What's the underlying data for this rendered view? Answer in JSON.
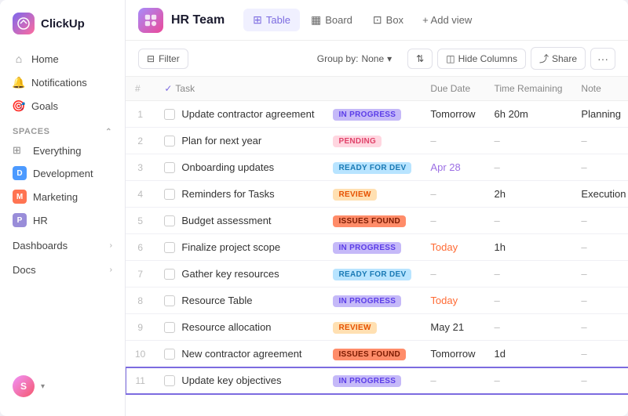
{
  "sidebar": {
    "logo": "ClickUp",
    "nav": [
      {
        "id": "home",
        "label": "Home",
        "icon": "⌂"
      },
      {
        "id": "notifications",
        "label": "Notifications",
        "icon": "🔔"
      },
      {
        "id": "goals",
        "label": "Goals",
        "icon": "🎯"
      }
    ],
    "spaces_label": "Spaces",
    "spaces": [
      {
        "id": "everything",
        "label": "Everything",
        "icon": null
      },
      {
        "id": "development",
        "label": "Development",
        "letter": "D",
        "color": "dot-blue"
      },
      {
        "id": "marketing",
        "label": "Marketing",
        "letter": "M",
        "color": "dot-orange"
      },
      {
        "id": "hr",
        "label": "HR",
        "letter": "P",
        "color": "dot-purple"
      }
    ],
    "bottom_nav": [
      {
        "id": "dashboards",
        "label": "Dashboards"
      },
      {
        "id": "docs",
        "label": "Docs"
      }
    ],
    "avatar_letter": "S"
  },
  "header": {
    "team_name": "HR Team",
    "tabs": [
      {
        "id": "table",
        "label": "Table",
        "icon": "⊞",
        "active": true
      },
      {
        "id": "board",
        "label": "Board",
        "icon": "▦",
        "active": false
      },
      {
        "id": "box",
        "label": "Box",
        "icon": "⊡",
        "active": false
      }
    ],
    "add_view": "+ Add view"
  },
  "toolbar": {
    "filter_label": "Filter",
    "group_by_label": "Group by:",
    "group_by_value": "None",
    "hide_columns_label": "Hide Columns",
    "share_label": "Share"
  },
  "table": {
    "columns": [
      "#",
      "Task",
      "",
      "Due Date",
      "Time Remaining",
      "Note"
    ],
    "rows": [
      {
        "num": 1,
        "task": "Update contractor agreement",
        "status": "IN PROGRESS",
        "status_type": "inprogress",
        "due": "Tomorrow",
        "due_type": "tomorrow",
        "time": "6h 20m",
        "note": "Planning"
      },
      {
        "num": 2,
        "task": "Plan for next year",
        "status": "PENDING",
        "status_type": "pending",
        "due": "–",
        "due_type": "dash",
        "time": "–",
        "note": "–"
      },
      {
        "num": 3,
        "task": "Onboarding updates",
        "status": "READY FOR DEV",
        "status_type": "readyfordev",
        "due": "Apr 28",
        "due_type": "apr",
        "time": "–",
        "note": "–"
      },
      {
        "num": 4,
        "task": "Reminders for Tasks",
        "status": "REVIEW",
        "status_type": "review",
        "due": "–",
        "due_type": "dash",
        "time": "2h",
        "note": "Execution"
      },
      {
        "num": 5,
        "task": "Budget assessment",
        "status": "ISSUES FOUND",
        "status_type": "issuesfound",
        "due": "–",
        "due_type": "dash",
        "time": "–",
        "note": "–"
      },
      {
        "num": 6,
        "task": "Finalize project scope",
        "status": "IN PROGRESS",
        "status_type": "inprogress",
        "due": "Today",
        "due_type": "today",
        "time": "1h",
        "note": "–"
      },
      {
        "num": 7,
        "task": "Gather key resources",
        "status": "READY FOR DEV",
        "status_type": "readyfordev",
        "due": "–",
        "due_type": "dash",
        "time": "–",
        "note": "–"
      },
      {
        "num": 8,
        "task": "Resource Table",
        "status": "IN PROGRESS",
        "status_type": "inprogress",
        "due": "Today",
        "due_type": "today",
        "time": "–",
        "note": "–"
      },
      {
        "num": 9,
        "task": "Resource allocation",
        "status": "REVIEW",
        "status_type": "review",
        "due": "May 21",
        "due_type": "may",
        "time": "–",
        "note": "–"
      },
      {
        "num": 10,
        "task": "New contractor agreement",
        "status": "ISSUES FOUND",
        "status_type": "issuesfound",
        "due": "Tomorrow",
        "due_type": "tomorrow",
        "time": "1d",
        "note": "–"
      },
      {
        "num": 11,
        "task": "Update key objectives",
        "status": "IN PROGRESS",
        "status_type": "inprogress",
        "due": "–",
        "due_type": "dash",
        "time": "–",
        "note": "–"
      }
    ]
  }
}
